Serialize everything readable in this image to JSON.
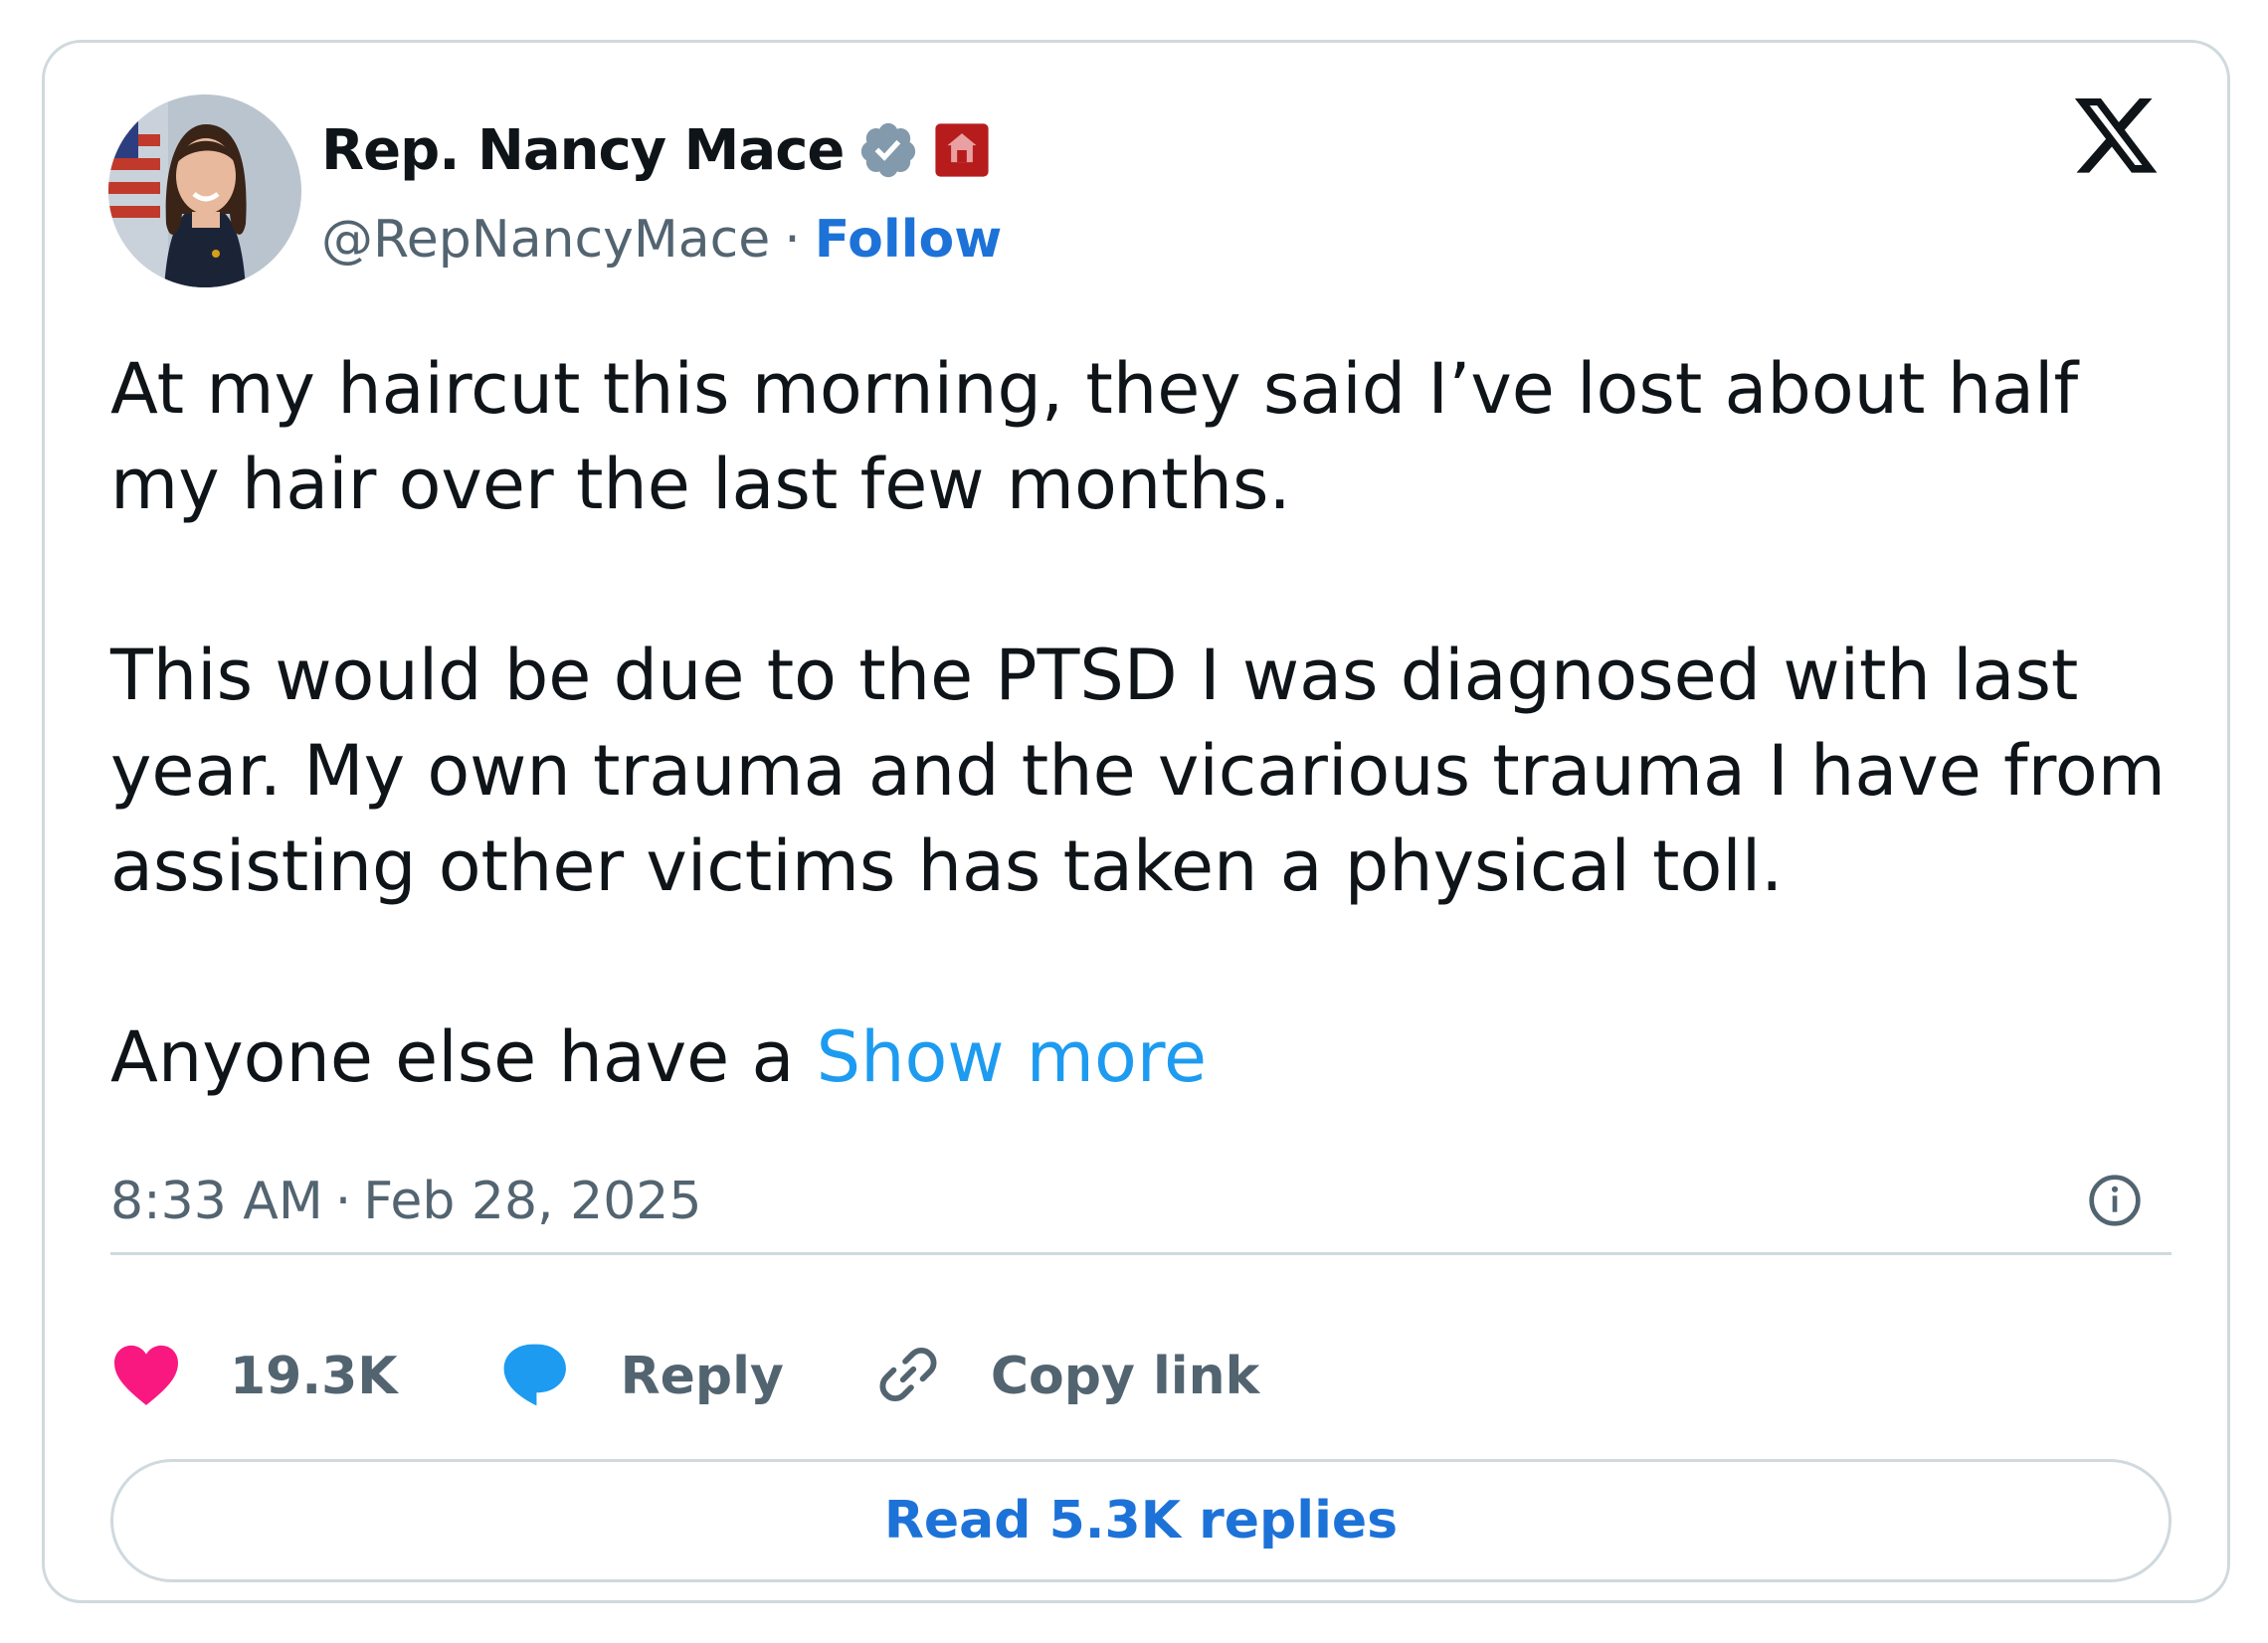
{
  "author": {
    "display_name": "Rep. Nancy Mace",
    "handle": "@RepNancyMace",
    "separator": "·",
    "follow_label": "Follow",
    "verified_badge_icon": "verified-badge-icon",
    "affiliate_badge_icon": "house-affiliate-badge-icon"
  },
  "tweet": {
    "paragraph_1": "At my haircut this morning, they said I’ve lost about half my hair over the last few months.",
    "paragraph_2": "This would be due to the PTSD I was diagnosed with last year. My own trauma and the vicarious trauma I have from assisting other victims has taken a physical toll.",
    "paragraph_3_prefix": "Anyone else have a ",
    "show_more_label": "Show more"
  },
  "meta": {
    "time": "8:33 AM",
    "separator": "·",
    "date": "Feb 28, 2025",
    "info_icon": "info-icon"
  },
  "actions": {
    "likes_count": "19.3K",
    "reply_label": "Reply",
    "copy_link_label": "Copy link"
  },
  "read_replies_label": "Read 5.3K replies",
  "colors": {
    "link_blue": "#1d72d8",
    "show_more_blue": "#1d9bf0",
    "heart_pink": "#f91880",
    "reply_blue": "#1d9bf0",
    "verified_gray": "#829aab",
    "affiliate_red": "#b71c1c",
    "secondary_text": "#536471",
    "border": "#cfd9de"
  }
}
